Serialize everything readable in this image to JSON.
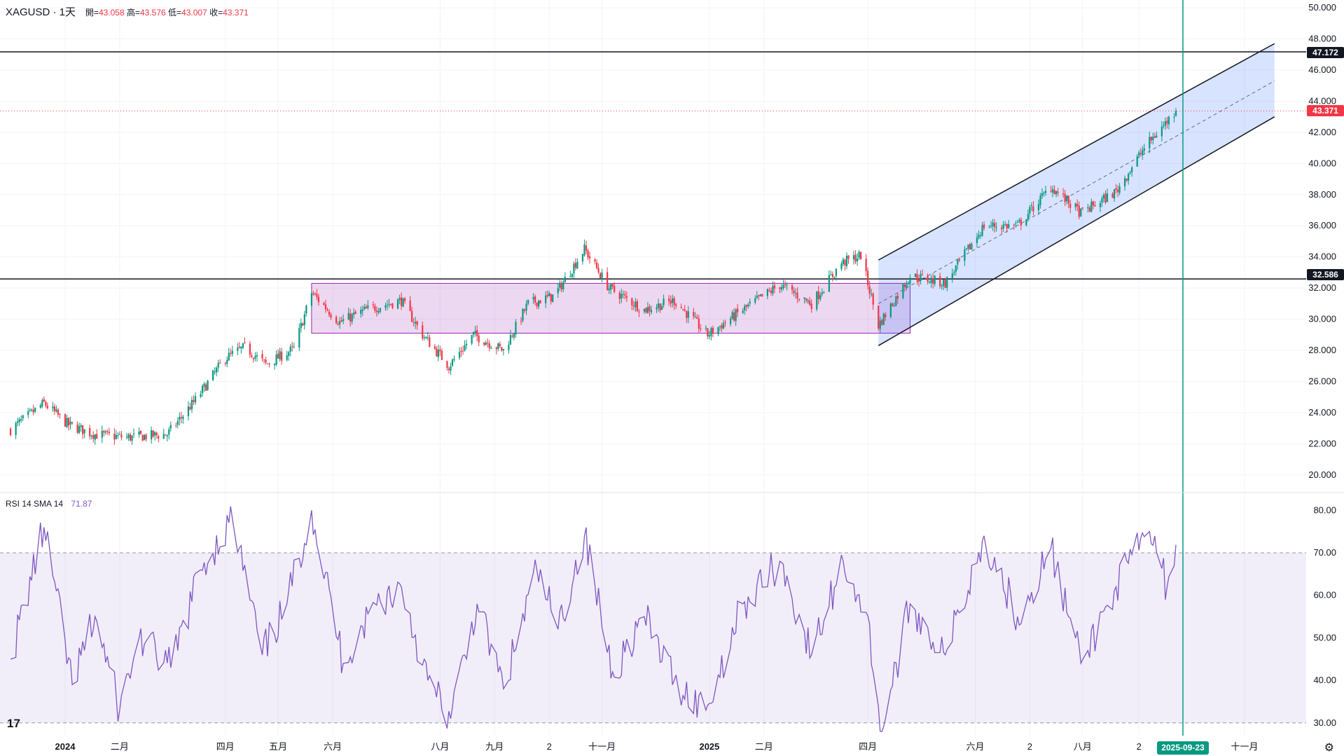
{
  "header": {
    "symbol": "XAGUSD · 1天",
    "open_label": "開=",
    "open": "43.058",
    "high_label": "高=",
    "high": "43.576",
    "low_label": "低=",
    "low": "43.007",
    "close_label": "收=",
    "close": "43.371"
  },
  "rsi_header": {
    "label": "RSI 14 SMA 14",
    "value": "71.87"
  },
  "price_tags": {
    "resistance": "47.172",
    "current": "43.371",
    "support": "32.586"
  },
  "crosshair_date": "2025-09-23",
  "logo": "17",
  "settings_icon": "gear-icon",
  "colors": {
    "up": "#089981",
    "down": "#f23645",
    "rsi": "#7e57c2",
    "channel": "#2962ff",
    "box": "#9c27b0",
    "crosshair": "#089981"
  },
  "chart_data": [
    {
      "type": "candlestick",
      "symbol": "XAGUSD",
      "timeframe": "1天",
      "y_ticks": [
        "20.000",
        "22.000",
        "24.000",
        "26.000",
        "28.000",
        "30.000",
        "32.000",
        "34.000",
        "36.000",
        "38.000",
        "40.000",
        "42.000",
        "44.000",
        "46.000",
        "48.000",
        "50.000"
      ],
      "ylim": [
        19,
        50.5
      ],
      "x_ticks": [
        "2024",
        "二月",
        "四月",
        "五月",
        "六月",
        "八月",
        "九月",
        "2",
        "十一月",
        "2025",
        "二月",
        "四月",
        "六月",
        "2",
        "八月",
        "2",
        "十一月"
      ],
      "close_trend": [
        {
          "date": "2023-12-01",
          "close": 22.9
        },
        {
          "date": "2023-12-20",
          "close": 24.6
        },
        {
          "date": "2024-01-03",
          "close": 23.2
        },
        {
          "date": "2024-01-18",
          "close": 22.6
        },
        {
          "date": "2024-02-05",
          "close": 22.4
        },
        {
          "date": "2024-02-28",
          "close": 22.6
        },
        {
          "date": "2024-03-15",
          "close": 24.8
        },
        {
          "date": "2024-04-01",
          "close": 27.5
        },
        {
          "date": "2024-04-12",
          "close": 28.2
        },
        {
          "date": "2024-04-24",
          "close": 27.1
        },
        {
          "date": "2024-05-10",
          "close": 28.1
        },
        {
          "date": "2024-05-20",
          "close": 31.7
        },
        {
          "date": "2024-06-05",
          "close": 29.8
        },
        {
          "date": "2024-06-20",
          "close": 30.6
        },
        {
          "date": "2024-07-10",
          "close": 31.2
        },
        {
          "date": "2024-07-22",
          "close": 29.0
        },
        {
          "date": "2024-08-06",
          "close": 27.0
        },
        {
          "date": "2024-08-20",
          "close": 29.0
        },
        {
          "date": "2024-09-06",
          "close": 28.0
        },
        {
          "date": "2024-09-20",
          "close": 31.0
        },
        {
          "date": "2024-10-05",
          "close": 31.5
        },
        {
          "date": "2024-10-22",
          "close": 34.5
        },
        {
          "date": "2024-11-05",
          "close": 32.0
        },
        {
          "date": "2024-11-25",
          "close": 30.6
        },
        {
          "date": "2024-12-12",
          "close": 31.2
        },
        {
          "date": "2024-12-31",
          "close": 29.0
        },
        {
          "date": "2025-01-20",
          "close": 30.6
        },
        {
          "date": "2025-02-10",
          "close": 32.2
        },
        {
          "date": "2025-02-28",
          "close": 31.0
        },
        {
          "date": "2025-03-17",
          "close": 33.6
        },
        {
          "date": "2025-03-28",
          "close": 34.1
        },
        {
          "date": "2025-04-07",
          "close": 29.6
        },
        {
          "date": "2025-04-25",
          "close": 32.8
        },
        {
          "date": "2025-05-15",
          "close": 32.3
        },
        {
          "date": "2025-06-06",
          "close": 36.0
        },
        {
          "date": "2025-06-25",
          "close": 36.0
        },
        {
          "date": "2025-07-14",
          "close": 38.5
        },
        {
          "date": "2025-07-31",
          "close": 36.8
        },
        {
          "date": "2025-08-20",
          "close": 38.2
        },
        {
          "date": "2025-09-05",
          "close": 41.0
        },
        {
          "date": "2025-09-23",
          "close": 43.371
        }
      ],
      "last_bar": {
        "date": "2025-09-23",
        "open": 43.058,
        "high": 43.576,
        "low": 43.007,
        "close": 43.371
      },
      "horizontal_lines": [
        47.172,
        32.586
      ],
      "range_box": {
        "from": "2024-05-20",
        "to": "2025-04-25",
        "top": 32.3,
        "bottom": 29.1
      },
      "channel": {
        "from": "2025-04-07",
        "to": "2025-11-18",
        "upper": [
          33.8,
          47.7
        ],
        "middle": [
          31.0,
          45.3
        ],
        "lower": [
          28.3,
          43.0
        ]
      }
    },
    {
      "type": "line",
      "name": "RSI 14 SMA 14",
      "last_value": 71.87,
      "y_ticks": [
        "30.00",
        "40.00",
        "50.00",
        "60.00",
        "70.00",
        "80.00"
      ],
      "ylim": [
        27,
        84
      ],
      "bands": [
        30,
        70
      ],
      "points": [
        {
          "date": "2023-12-01",
          "v": 45
        },
        {
          "date": "2023-12-20",
          "v": 76
        },
        {
          "date": "2024-01-05",
          "v": 39
        },
        {
          "date": "2024-01-18",
          "v": 55
        },
        {
          "date": "2024-02-01",
          "v": 33
        },
        {
          "date": "2024-02-12",
          "v": 50
        },
        {
          "date": "2024-03-01",
          "v": 43
        },
        {
          "date": "2024-03-18",
          "v": 66
        },
        {
          "date": "2024-04-05",
          "v": 78
        },
        {
          "date": "2024-04-22",
          "v": 46
        },
        {
          "date": "2024-05-06",
          "v": 58
        },
        {
          "date": "2024-05-20",
          "v": 80
        },
        {
          "date": "2024-06-07",
          "v": 44
        },
        {
          "date": "2024-06-25",
          "v": 58
        },
        {
          "date": "2024-07-10",
          "v": 62
        },
        {
          "date": "2024-07-25",
          "v": 40
        },
        {
          "date": "2024-08-07",
          "v": 31
        },
        {
          "date": "2024-08-22",
          "v": 58
        },
        {
          "date": "2024-09-06",
          "v": 38
        },
        {
          "date": "2024-09-25",
          "v": 66
        },
        {
          "date": "2024-10-07",
          "v": 52
        },
        {
          "date": "2024-10-22",
          "v": 74
        },
        {
          "date": "2024-11-07",
          "v": 42
        },
        {
          "date": "2024-11-25",
          "v": 55
        },
        {
          "date": "2024-12-12",
          "v": 40
        },
        {
          "date": "2024-12-30",
          "v": 33
        },
        {
          "date": "2025-01-20",
          "v": 58
        },
        {
          "date": "2025-02-10",
          "v": 68
        },
        {
          "date": "2025-02-28",
          "v": 46
        },
        {
          "date": "2025-03-18",
          "v": 68
        },
        {
          "date": "2025-03-31",
          "v": 56
        },
        {
          "date": "2025-04-09",
          "v": 28
        },
        {
          "date": "2025-04-25",
          "v": 58
        },
        {
          "date": "2025-05-15",
          "v": 46
        },
        {
          "date": "2025-06-06",
          "v": 74
        },
        {
          "date": "2025-06-25",
          "v": 55
        },
        {
          "date": "2025-07-14",
          "v": 71
        },
        {
          "date": "2025-07-31",
          "v": 44
        },
        {
          "date": "2025-08-20",
          "v": 62
        },
        {
          "date": "2025-09-08",
          "v": 75
        },
        {
          "date": "2025-09-18",
          "v": 62
        },
        {
          "date": "2025-09-23",
          "v": 71.87
        }
      ]
    }
  ]
}
